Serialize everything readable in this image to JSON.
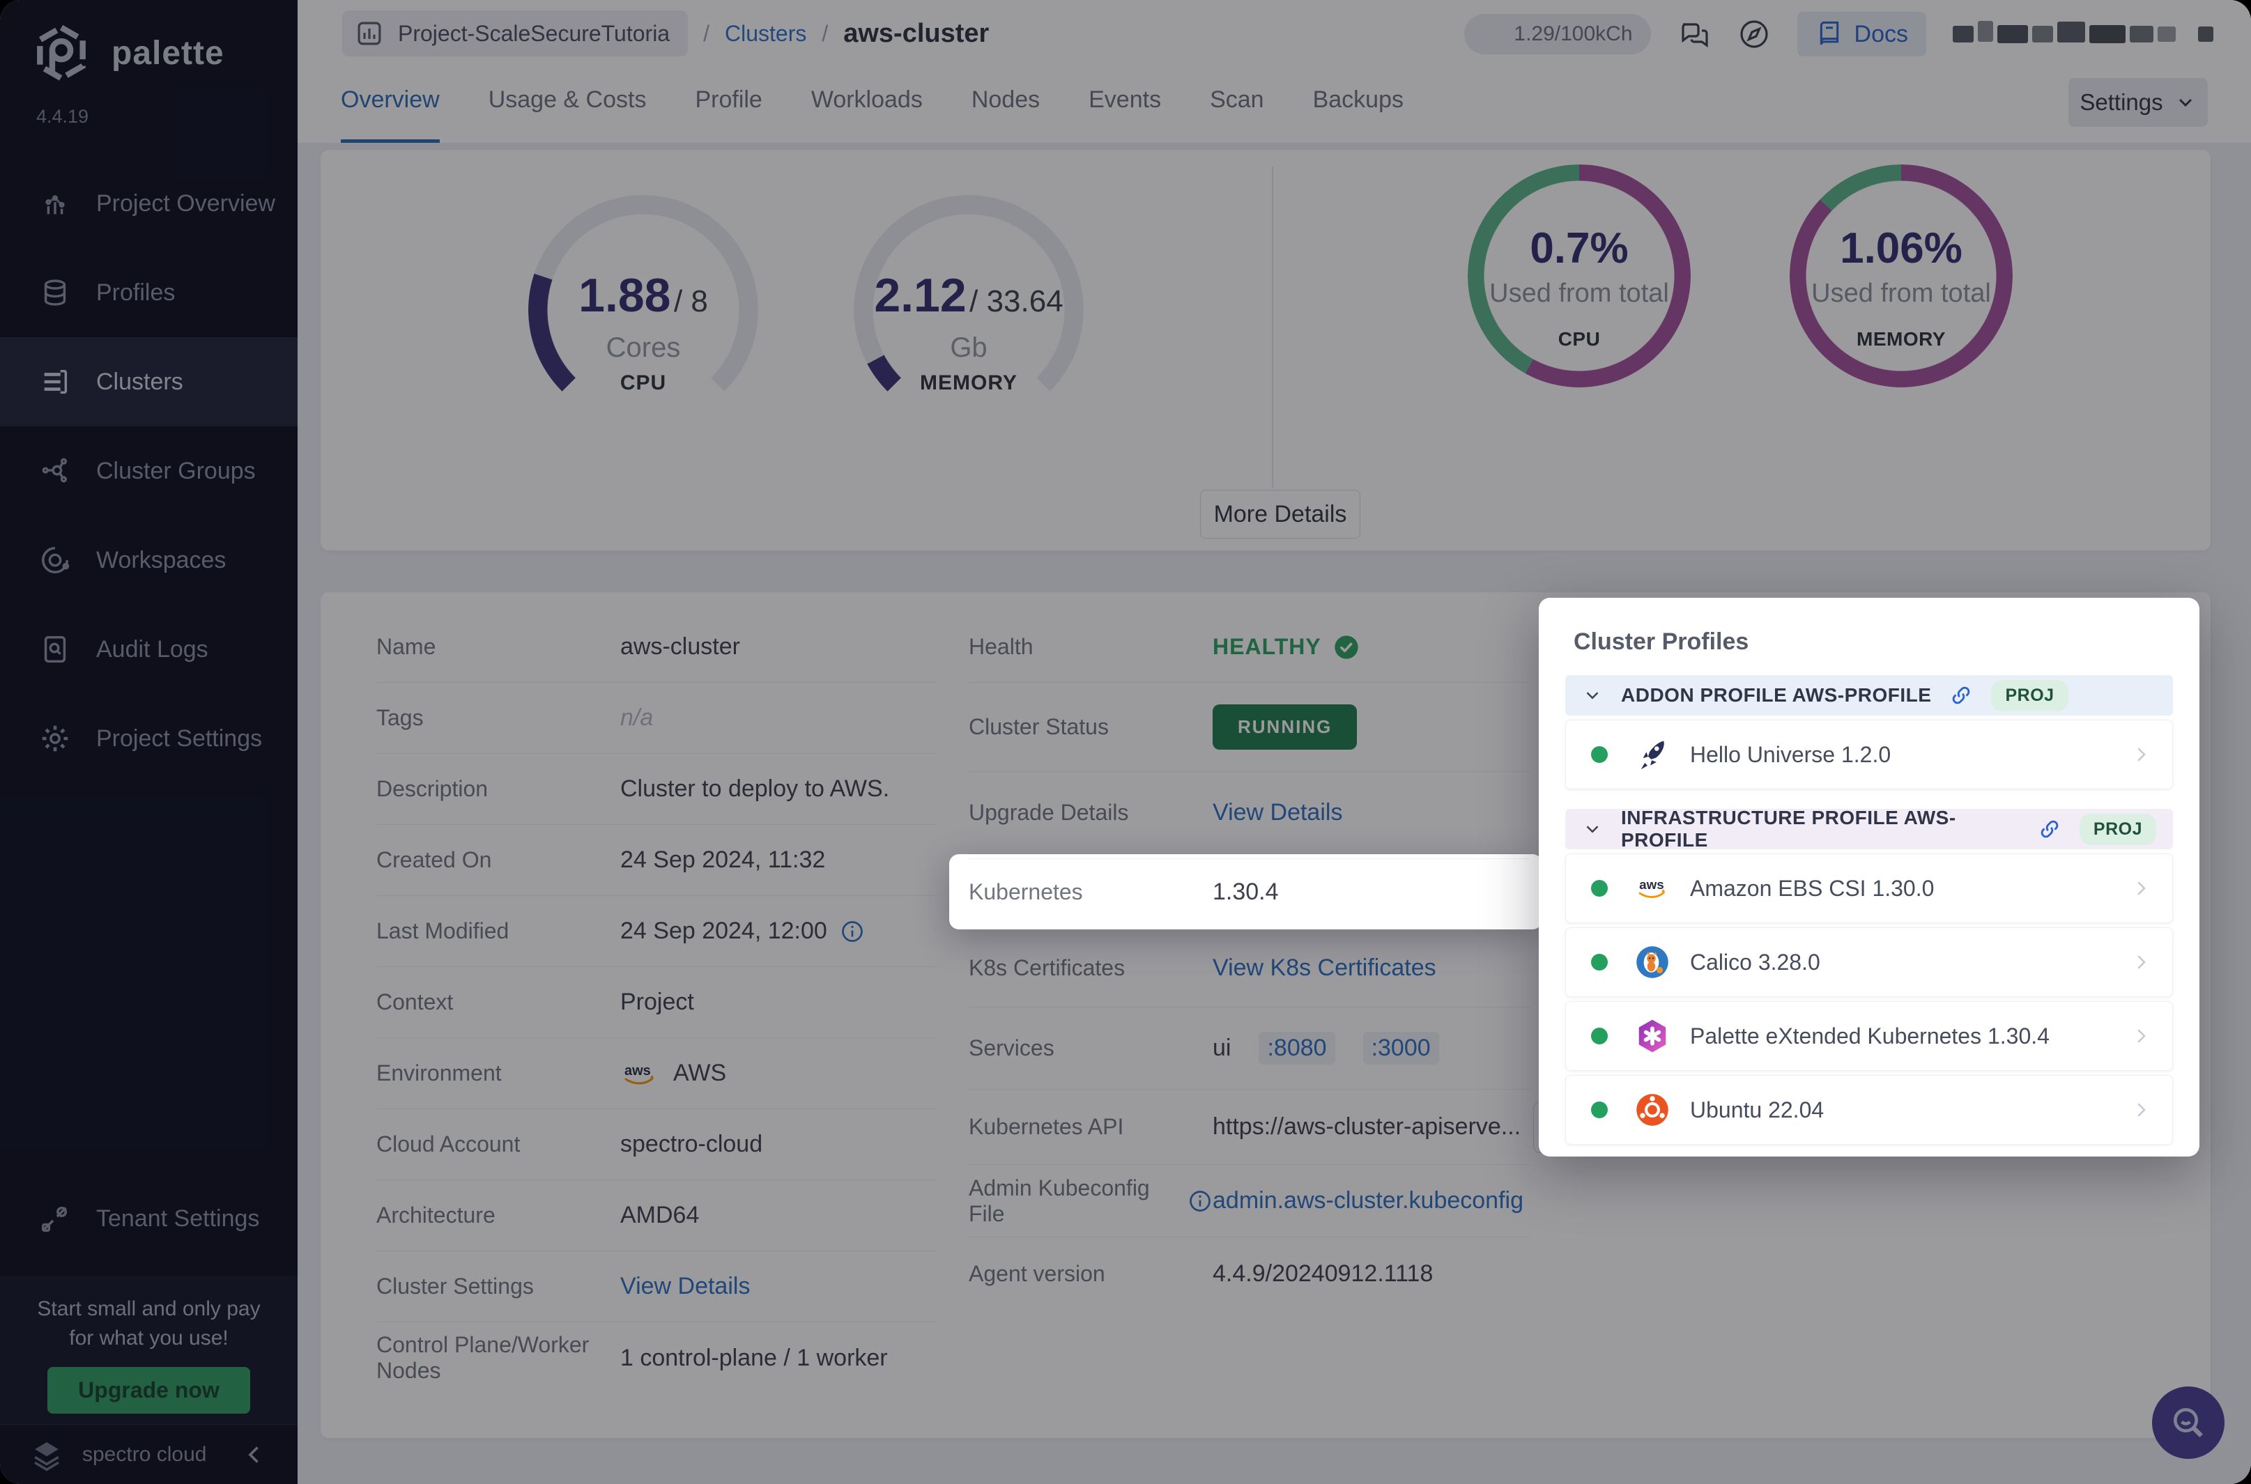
{
  "brand": {
    "name": "palette",
    "version": "4.4.19",
    "footer": "spectro cloud"
  },
  "sidebar": {
    "items": [
      {
        "label": "Project Overview"
      },
      {
        "label": "Profiles"
      },
      {
        "label": "Clusters"
      },
      {
        "label": "Cluster Groups"
      },
      {
        "label": "Workspaces"
      },
      {
        "label": "Audit Logs"
      },
      {
        "label": "Project Settings"
      }
    ],
    "active_item": "Clusters",
    "tenant": {
      "label": "Tenant Settings"
    },
    "promo": {
      "line1": "Start small and only pay",
      "line2": "for what you use!",
      "button": "Upgrade now"
    }
  },
  "header": {
    "project": "Project-ScaleSecureTutoria",
    "separator": "/",
    "breadcrumb_section": "Clusters",
    "breadcrumb_current": "aws-cluster",
    "usage": "1.29/100kCh",
    "docs": "Docs"
  },
  "tabs": {
    "items": [
      "Overview",
      "Usage & Costs",
      "Profile",
      "Workloads",
      "Nodes",
      "Events",
      "Scan",
      "Backups"
    ],
    "active": "Overview",
    "settings_button": "Settings"
  },
  "overview": {
    "gauges": [
      {
        "value": "1.88",
        "total": "/ 8",
        "unit": "Cores",
        "label": "CPU",
        "fraction": 0.235
      },
      {
        "value": "2.12",
        "total": "/ 33.64",
        "unit": "Gb",
        "label": "MEMORY",
        "fraction": 0.063
      }
    ],
    "donuts": [
      {
        "pct": "0.7%",
        "caption": "Used from total",
        "label": "CPU",
        "used_fraction": 0.58
      },
      {
        "pct": "1.06%",
        "caption": "Used from total",
        "label": "MEMORY",
        "used_fraction": 0.87
      }
    ],
    "more_details": "More Details"
  },
  "details": {
    "name": {
      "label": "Name",
      "value": "aws-cluster"
    },
    "tags": {
      "label": "Tags",
      "value": "n/a"
    },
    "description": {
      "label": "Description",
      "value": "Cluster to deploy to AWS."
    },
    "created_on": {
      "label": "Created On",
      "value": "24 Sep 2024, 11:32"
    },
    "last_modified": {
      "label": "Last Modified",
      "value": "24 Sep 2024, 12:00"
    },
    "context": {
      "label": "Context",
      "value": "Project"
    },
    "environment": {
      "label": "Environment",
      "value": "AWS"
    },
    "cloud_account": {
      "label": "Cloud Account",
      "value": "spectro-cloud"
    },
    "architecture": {
      "label": "Architecture",
      "value": "AMD64"
    },
    "cluster_settings": {
      "label": "Cluster Settings",
      "link": "View Details"
    },
    "nodes": {
      "label": "Control Plane/Worker Nodes",
      "value": "1 control-plane / 1 worker"
    },
    "health": {
      "label": "Health",
      "value": "HEALTHY"
    },
    "cluster_status": {
      "label": "Cluster Status",
      "value": "RUNNING"
    },
    "upgrade_details": {
      "label": "Upgrade Details",
      "link": "View Details"
    },
    "kubernetes": {
      "label": "Kubernetes",
      "value": "1.30.4"
    },
    "k8s_certificates": {
      "label": "K8s Certificates",
      "link": "View K8s Certificates"
    },
    "services": {
      "label": "Services",
      "prefix": "ui",
      "ports": [
        ":8080",
        ":3000"
      ]
    },
    "kubernetes_api": {
      "label": "Kubernetes API",
      "value": "https://aws-cluster-apiserve..."
    },
    "admin_kubeconfig": {
      "label": "Admin Kubeconfig File",
      "link": "admin.aws-cluster.kubeconfig"
    },
    "agent_version": {
      "label": "Agent version",
      "value": "4.4.9/20240912.1118"
    }
  },
  "cluster_profiles": {
    "title": "Cluster Profiles",
    "sections": [
      {
        "header": "ADDON PROFILE AWS-PROFILE",
        "badge": "PROJ",
        "items": [
          {
            "name": "Hello Universe 1.2.0"
          }
        ]
      },
      {
        "header": "INFRASTRUCTURE PROFILE AWS-PROFILE",
        "badge": "PROJ",
        "items": [
          {
            "name": "Amazon EBS CSI 1.30.0"
          },
          {
            "name": "Calico 3.28.0"
          },
          {
            "name": "Palette eXtended Kubernetes 1.30.4"
          },
          {
            "name": "Ubuntu 22.04"
          }
        ]
      }
    ]
  },
  "colors": {
    "accent_indigo": "#37316f",
    "link_blue": "#2e6fc0",
    "healthy_green": "#2da05f",
    "running_green": "#1f7c4c",
    "donut_purple": "#a3509a",
    "donut_green": "#5bb488",
    "upgrade_green": "#2f9e63",
    "sidebar_bg": "#0e0f20"
  }
}
